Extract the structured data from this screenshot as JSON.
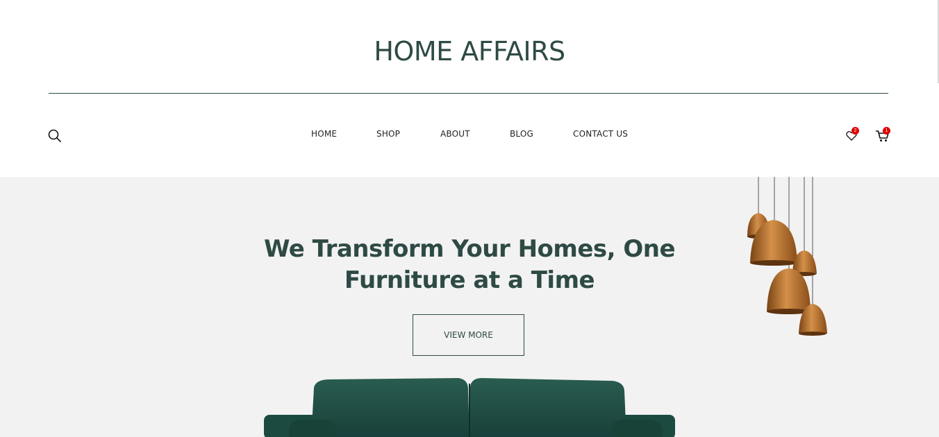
{
  "brand": {
    "name": "HOME AFFAIRS"
  },
  "nav": {
    "items": [
      {
        "label": "HOME"
      },
      {
        "label": "SHOP"
      },
      {
        "label": "ABOUT"
      },
      {
        "label": "BLOG"
      },
      {
        "label": "CONTACT US"
      }
    ]
  },
  "icons": {
    "search": "search-icon",
    "wishlist": "heart-icon",
    "cart": "cart-icon"
  },
  "wishlist": {
    "count": "2"
  },
  "cart": {
    "count": "1"
  },
  "hero": {
    "headline_line1": "We Transform Your Homes, One",
    "headline_line2": "Furniture at a Time",
    "cta_label": "VIEW MORE"
  },
  "colors": {
    "accent": "#2e4a44",
    "hero_bg": "#f2f2f2",
    "badge": "#e10000",
    "lamp": "#b8732f",
    "sofa": "#1f4d43"
  }
}
